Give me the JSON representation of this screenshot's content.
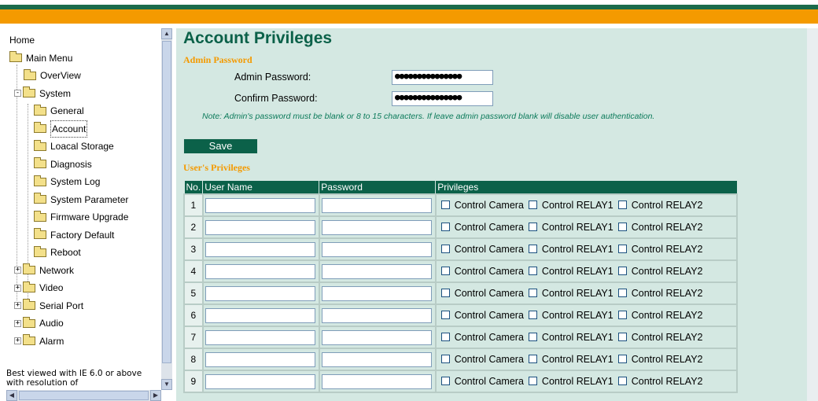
{
  "sidebar": {
    "items": [
      {
        "label": "Home"
      },
      {
        "label": "Main Menu"
      },
      {
        "label": "OverView"
      },
      {
        "label": "System"
      },
      {
        "label": "General"
      },
      {
        "label": "Account"
      },
      {
        "label": "Loacal Storage"
      },
      {
        "label": "Diagnosis"
      },
      {
        "label": "System Log"
      },
      {
        "label": "System Parameter"
      },
      {
        "label": "Firmware Upgrade"
      },
      {
        "label": "Factory Default"
      },
      {
        "label": "Reboot"
      },
      {
        "label": "Network"
      },
      {
        "label": "Video"
      },
      {
        "label": "Serial Port"
      },
      {
        "label": "Audio"
      },
      {
        "label": "Alarm"
      }
    ],
    "selected": "Account",
    "note": "Best viewed with IE 6.0 or above with resolution of"
  },
  "main": {
    "title": "Account Privileges",
    "admin_section": "Admin Password",
    "admin_password_label": "Admin Password:",
    "admin_password_value": "●●●●●●●●●●●●●●●",
    "confirm_password_label": "Confirm Password:",
    "confirm_password_value": "●●●●●●●●●●●●●●●",
    "note": "Note: Admin's password must be blank or 8 to 15 characters. If leave admin password blank will disable user authentication.",
    "save_label": "Save",
    "users_section": "User's Privileges",
    "table": {
      "headers": [
        "No.",
        "User Name",
        "Password",
        "Privileges"
      ],
      "privileges": [
        "Control Camera",
        "Control RELAY1",
        "Control RELAY2"
      ],
      "rows": [
        "1",
        "2",
        "3",
        "4",
        "5",
        "6",
        "7",
        "8",
        "9"
      ]
    }
  },
  "colors": {
    "accent_green": "#0b6149",
    "accent_orange": "#f49a00",
    "panel_bg": "#d4e8e2"
  }
}
